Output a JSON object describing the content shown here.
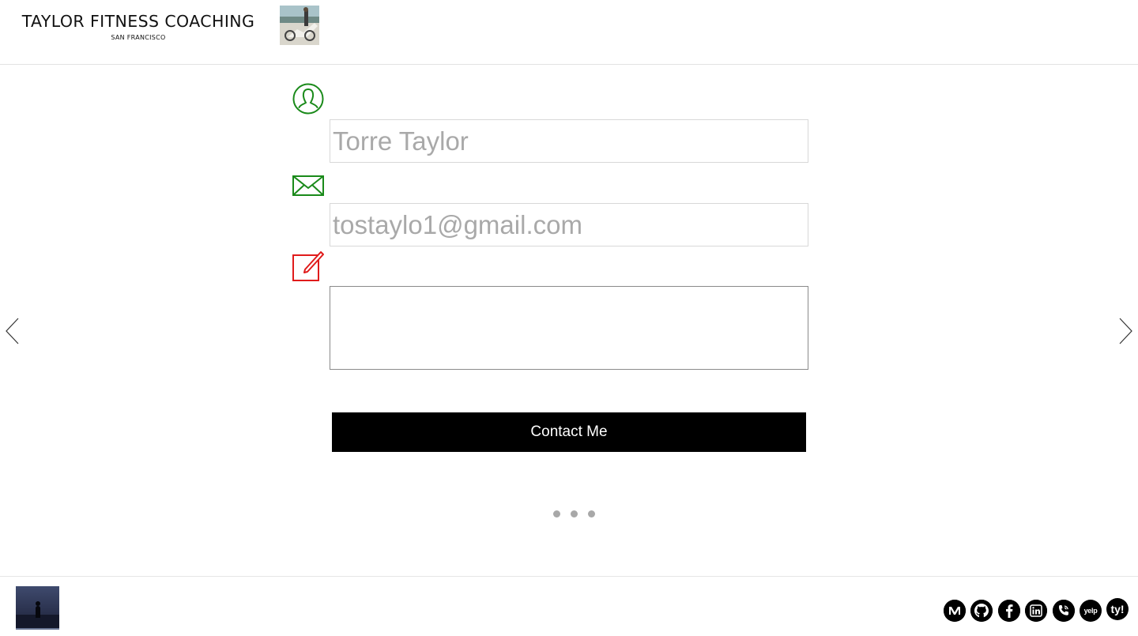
{
  "header": {
    "brand_title": "TAYLOR FITNESS COACHING",
    "brand_subtitle": "SAN FRANCISCO",
    "thumbnail_icon": "header-photo-thumbnail"
  },
  "form": {
    "name_icon": "person-icon",
    "name_value": "Torre Taylor",
    "email_icon": "envelope-icon",
    "email_value": "tostaylo1@gmail.com",
    "message_icon": "edit-icon",
    "message_value": "",
    "submit_label": "Contact Me"
  },
  "slider": {
    "prev_icon": "chevron-left-icon",
    "next_icon": "chevron-right-icon",
    "dots_count": 3
  },
  "footer": {
    "thumbnail_icon": "footer-photo-thumbnail",
    "social": [
      {
        "name": "medium",
        "icon": "medium-icon"
      },
      {
        "name": "github",
        "icon": "github-icon"
      },
      {
        "name": "facebook",
        "icon": "facebook-icon"
      },
      {
        "name": "linkedin",
        "icon": "linkedin-icon"
      },
      {
        "name": "phone",
        "icon": "phone-icon"
      },
      {
        "name": "yelp",
        "icon": "yelp-icon",
        "label": "yelp"
      },
      {
        "name": "ty",
        "icon": "ty-logo-icon",
        "label": "ty!"
      }
    ]
  },
  "colors": {
    "icon_green": "#1a8a1a",
    "icon_red": "#e01b1b",
    "button_bg": "#000000",
    "placeholder_text": "#a9a9a9",
    "dot_gray": "#a8a8a8"
  }
}
